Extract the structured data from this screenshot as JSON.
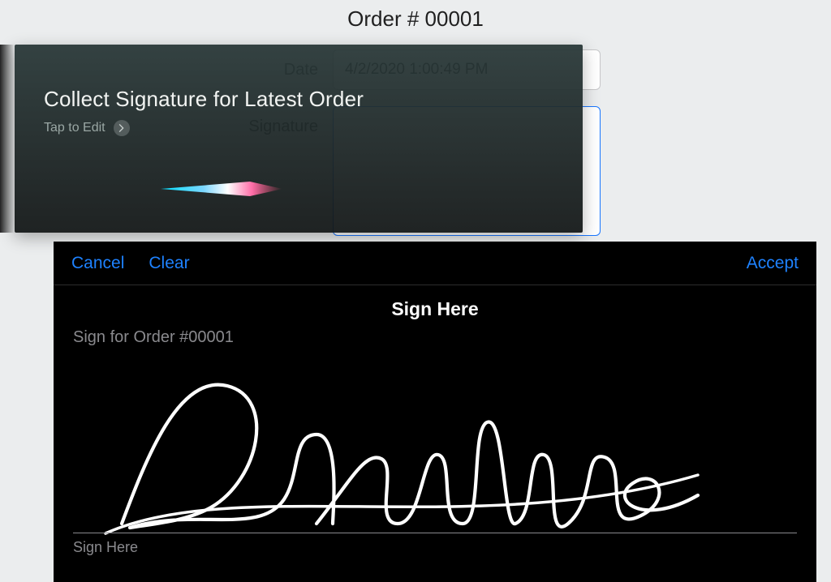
{
  "page": {
    "title": "Order # 00001"
  },
  "form": {
    "date_label": "Date",
    "date_value": "4/2/2020 1:00:49 PM",
    "signature_label": "Signature"
  },
  "siri": {
    "title": "Collect Signature for Latest Order",
    "subtitle": "Tap to Edit"
  },
  "sign_panel": {
    "cancel": "Cancel",
    "clear": "Clear",
    "accept": "Accept",
    "heading": "Sign Here",
    "subheading": "Sign for Order #00001",
    "line_label": "Sign Here"
  },
  "colors": {
    "link_blue": "#1e82ff",
    "field_border_active": "#1976ff"
  }
}
